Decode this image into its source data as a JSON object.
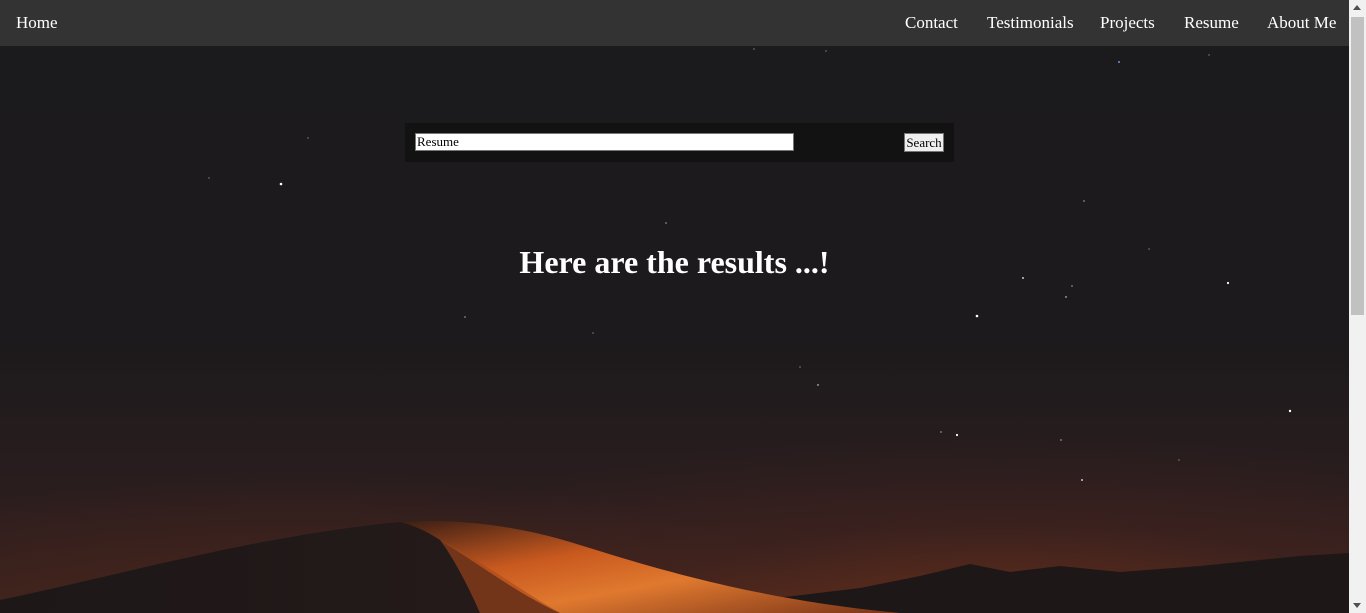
{
  "nav": {
    "home": "Home",
    "links": [
      "Contact",
      "Testimonials",
      "Projects",
      "Resume",
      "About Me"
    ]
  },
  "search": {
    "value": "Resume",
    "button_label": "Search"
  },
  "results": {
    "heading": "Here are the results ...!"
  },
  "colors": {
    "navbar_bg": "#333333",
    "sky": "#1b1a1c",
    "dune_glow": "#e0792f"
  }
}
